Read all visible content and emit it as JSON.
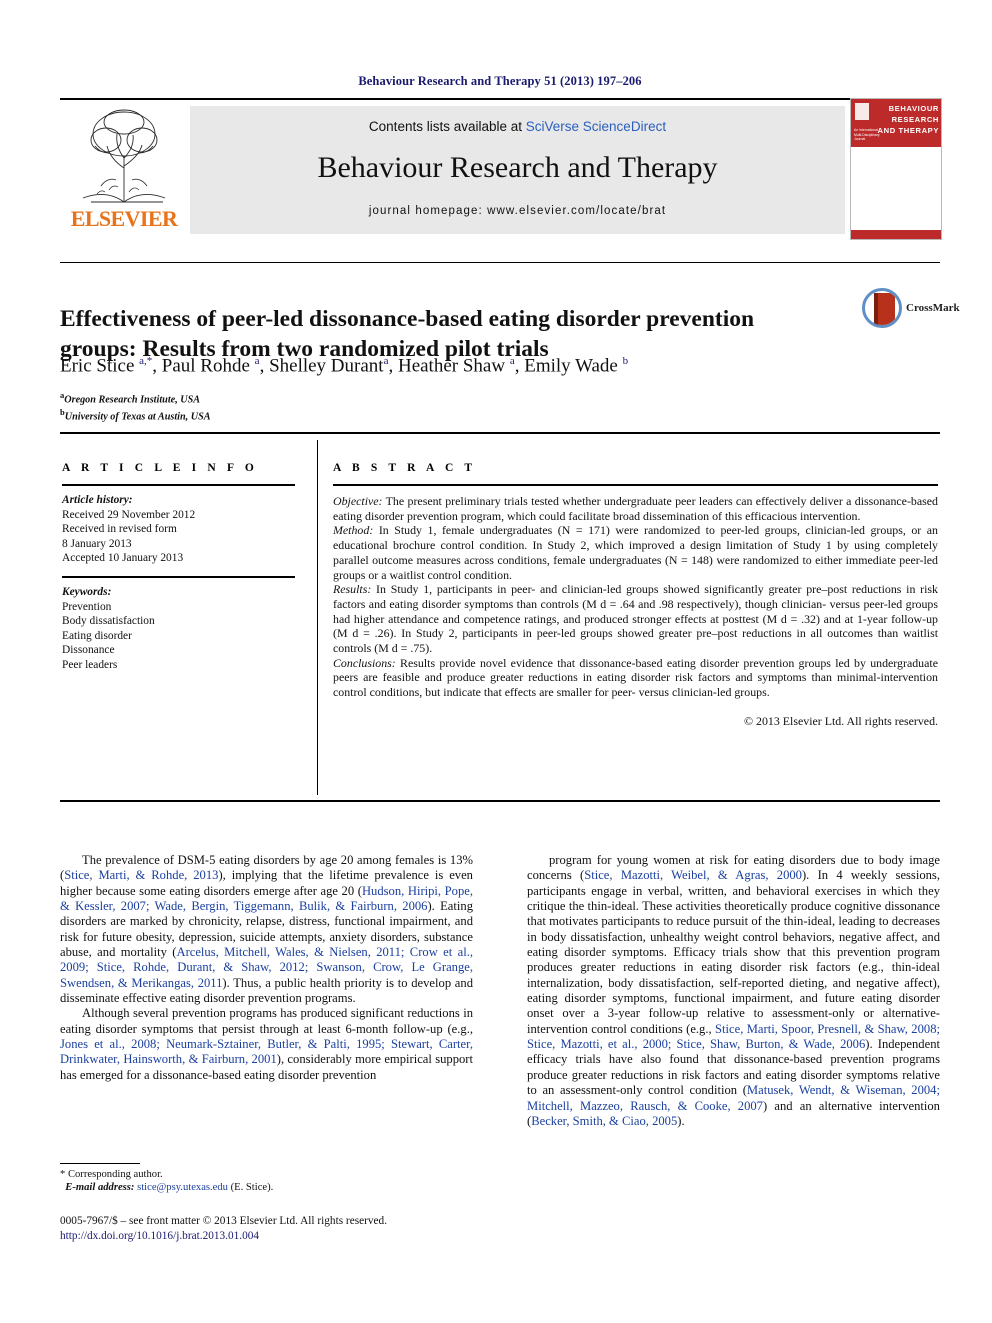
{
  "running_head": "Behaviour Research and Therapy 51 (2013) 197–206",
  "masthead": {
    "contents_prefix": "Contents lists available at ",
    "contents_link": "SciVerse ScienceDirect",
    "journal_title": "Behaviour Research and Therapy",
    "homepage": "journal homepage: www.elsevier.com/locate/brat",
    "publisher_name": "ELSEVIER",
    "cover_title": "BEHAVIOUR RESEARCH AND THERAPY",
    "cover_subtitle": "An International Multi-Disciplinary Journal"
  },
  "article": {
    "title": "Effectiveness of peer-led dissonance-based eating disorder prevention groups: Results from two randomized pilot trials",
    "authors_html": "Eric Stice <sup>a,*</sup>, Paul Rohde <sup>a</sup>, Shelley Durant<sup>a</sup>, Heather Shaw <sup>a</sup>, Emily Wade <sup>b</sup>",
    "affiliation_a": "Oregon Research Institute, USA",
    "affiliation_b": "University of Texas at Austin, USA",
    "crossmark_label": "CrossMark"
  },
  "article_info": {
    "heading": "A R T I C L E   I N F O",
    "history_label": "Article history:",
    "history": [
      "Received 29 November 2012",
      "Received in revised form",
      "8 January 2013",
      "Accepted 10 January 2013"
    ],
    "keywords_label": "Keywords:",
    "keywords": [
      "Prevention",
      "Body dissatisfaction",
      "Eating disorder",
      "Dissonance",
      "Peer leaders"
    ]
  },
  "abstract": {
    "heading": "A B S T R A C T",
    "objective_label": "Objective:",
    "objective_text": " The present preliminary trials tested whether undergraduate peer leaders can effectively deliver a dissonance-based eating disorder prevention program, which could facilitate broad dissemination of this efficacious intervention.",
    "method_label": "Method:",
    "method_text": " In Study 1, female undergraduates (N = 171) were randomized to peer-led groups, clinician-led groups, or an educational brochure control condition. In Study 2, which improved a design limitation of Study 1 by using completely parallel outcome measures across conditions, female undergraduates (N = 148) were randomized to either immediate peer-led groups or a waitlist control condition.",
    "results_label": "Results:",
    "results_text": " In Study 1, participants in peer- and clinician-led groups showed significantly greater pre–post reductions in risk factors and eating disorder symptoms than controls (M d = .64 and .98 respectively), though clinician- versus peer-led groups had higher attendance and competence ratings, and produced stronger effects at posttest (M d = .32) and at 1-year follow-up (M d = .26). In Study 2, participants in peer-led groups showed greater pre–post reductions in all outcomes than waitlist controls (M d = .75).",
    "conclusions_label": "Conclusions:",
    "conclusions_text": " Results provide novel evidence that dissonance-based eating disorder prevention groups led by undergraduate peers are feasible and produce greater reductions in eating disorder risk factors and symptoms than minimal-intervention control conditions, but indicate that effects are smaller for peer- versus clinician-led groups.",
    "copyright": "© 2013 Elsevier Ltd. All rights reserved."
  },
  "body": {
    "left_p1_html": "The prevalence of DSM-5 eating disorders by age 20 among females is 13% (<span class=\"cite\">Stice, Marti, &amp; Rohde, 2013</span>), implying that the lifetime prevalence is even higher because some eating disorders emerge after age 20 (<span class=\"cite\">Hudson, Hiripi, Pope, &amp; Kessler, 2007; Wade, Bergin, Tiggemann, Bulik, &amp; Fairburn, 2006</span>). Eating disorders are marked by chronicity, relapse, distress, functional impairment, and risk for future obesity, depression, suicide attempts, anxiety disorders, substance abuse, and mortality (<span class=\"cite\">Arcelus, Mitchell, Wales, &amp; Nielsen, 2011; Crow et al., 2009; Stice, Rohde, Durant, &amp; Shaw, 2012; Swanson, Crow, Le Grange, Swendsen, &amp; Merikangas, 2011</span>). Thus, a public health priority is to develop and disseminate effective eating disorder prevention programs.",
    "left_p2_html": "Although several prevention programs has produced significant reductions in eating disorder symptoms that persist through at least 6-month follow-up (e.g., <span class=\"cite\">Jones et al., 2008; Neumark-Sztainer, Butler, &amp; Palti, 1995; Stewart, Carter, Drinkwater, Hainsworth, &amp; Fairburn, 2001</span>), considerably more empirical support has emerged for a dissonance-based eating disorder prevention",
    "right_p1_html": "program for young women at risk for eating disorders due to body image concerns (<span class=\"cite\">Stice, Mazotti, Weibel, &amp; Agras, 2000</span>). In 4 weekly sessions, participants engage in verbal, written, and behavioral exercises in which they critique the thin-ideal. These activities theoretically produce cognitive dissonance that motivates participants to reduce pursuit of the thin-ideal, leading to decreases in body dissatisfaction, unhealthy weight control behaviors, negative affect, and eating disorder symptoms. Efficacy trials show that this prevention program produces greater reductions in eating disorder risk factors (e.g., thin-ideal internalization, body dissatisfaction, self-reported dieting, and negative affect), eating disorder symptoms, functional impairment, and future eating disorder onset over a 3-year follow-up relative to assessment-only or alternative-intervention control conditions (e.g., <span class=\"cite\">Stice, Marti, Spoor, Presnell, &amp; Shaw, 2008; Stice, Mazotti, et al., 2000; Stice, Shaw, Burton, &amp; Wade, 2006</span>). Independent efficacy trials have also found that dissonance-based prevention programs produce greater reductions in risk factors and eating disorder symptoms relative to an assessment-only control condition (<span class=\"cite\">Matusek, Wendt, &amp; Wiseman, 2004; Mitchell, Mazzeo, Rausch, &amp; Cooke, 2007</span>) and an alternative intervention (<span class=\"cite\">Becker, Smith, &amp; Ciao, 2005</span>)."
  },
  "footnote": {
    "corresponding": "* Corresponding author.",
    "email_label": "E-mail address:",
    "email": "stice@psy.utexas.edu",
    "email_suffix": " (E. Stice)."
  },
  "footer": {
    "issn_line": "0005-7967/$ – see front matter © 2013 Elsevier Ltd. All rights reserved.",
    "doi": "http://dx.doi.org/10.1016/j.brat.2013.01.004"
  }
}
